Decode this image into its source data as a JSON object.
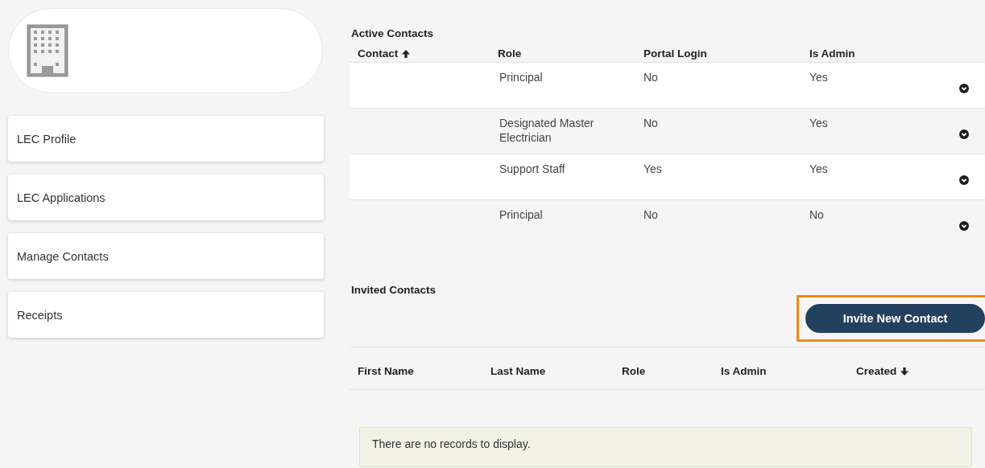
{
  "sidebar": {
    "items": [
      {
        "label": "LEC Profile"
      },
      {
        "label": "LEC Applications"
      },
      {
        "label": "Manage Contacts"
      },
      {
        "label": "Receipts"
      }
    ]
  },
  "active_contacts": {
    "title": "Active Contacts",
    "columns": [
      {
        "label": "Contact",
        "sorted": true,
        "ascending": true
      },
      {
        "label": "Role",
        "sorted": false
      },
      {
        "label": "Portal Login",
        "sorted": false
      },
      {
        "label": "Is Admin",
        "sorted": false
      }
    ],
    "rows": [
      {
        "role": "Principal",
        "portal_login": "No",
        "is_admin": "Yes"
      },
      {
        "role": "Designated Master Electrician",
        "portal_login": "No",
        "is_admin": "Yes"
      },
      {
        "role": "Support Staff",
        "portal_login": "Yes",
        "is_admin": "Yes"
      },
      {
        "role": "Principal",
        "portal_login": "No",
        "is_admin": "No"
      }
    ]
  },
  "invited_contacts": {
    "title": "Invited Contacts",
    "invite_button": {
      "label": "Invite New Contact",
      "highlighted": true
    },
    "columns": [
      {
        "label": "First Name",
        "sorted": false
      },
      {
        "label": "Last Name",
        "sorted": false
      },
      {
        "label": "Role",
        "sorted": false
      },
      {
        "label": "Is Admin",
        "sorted": false
      },
      {
        "label": "Created",
        "sorted": true,
        "ascending": false
      }
    ],
    "empty_message": "There are no records to display."
  }
}
